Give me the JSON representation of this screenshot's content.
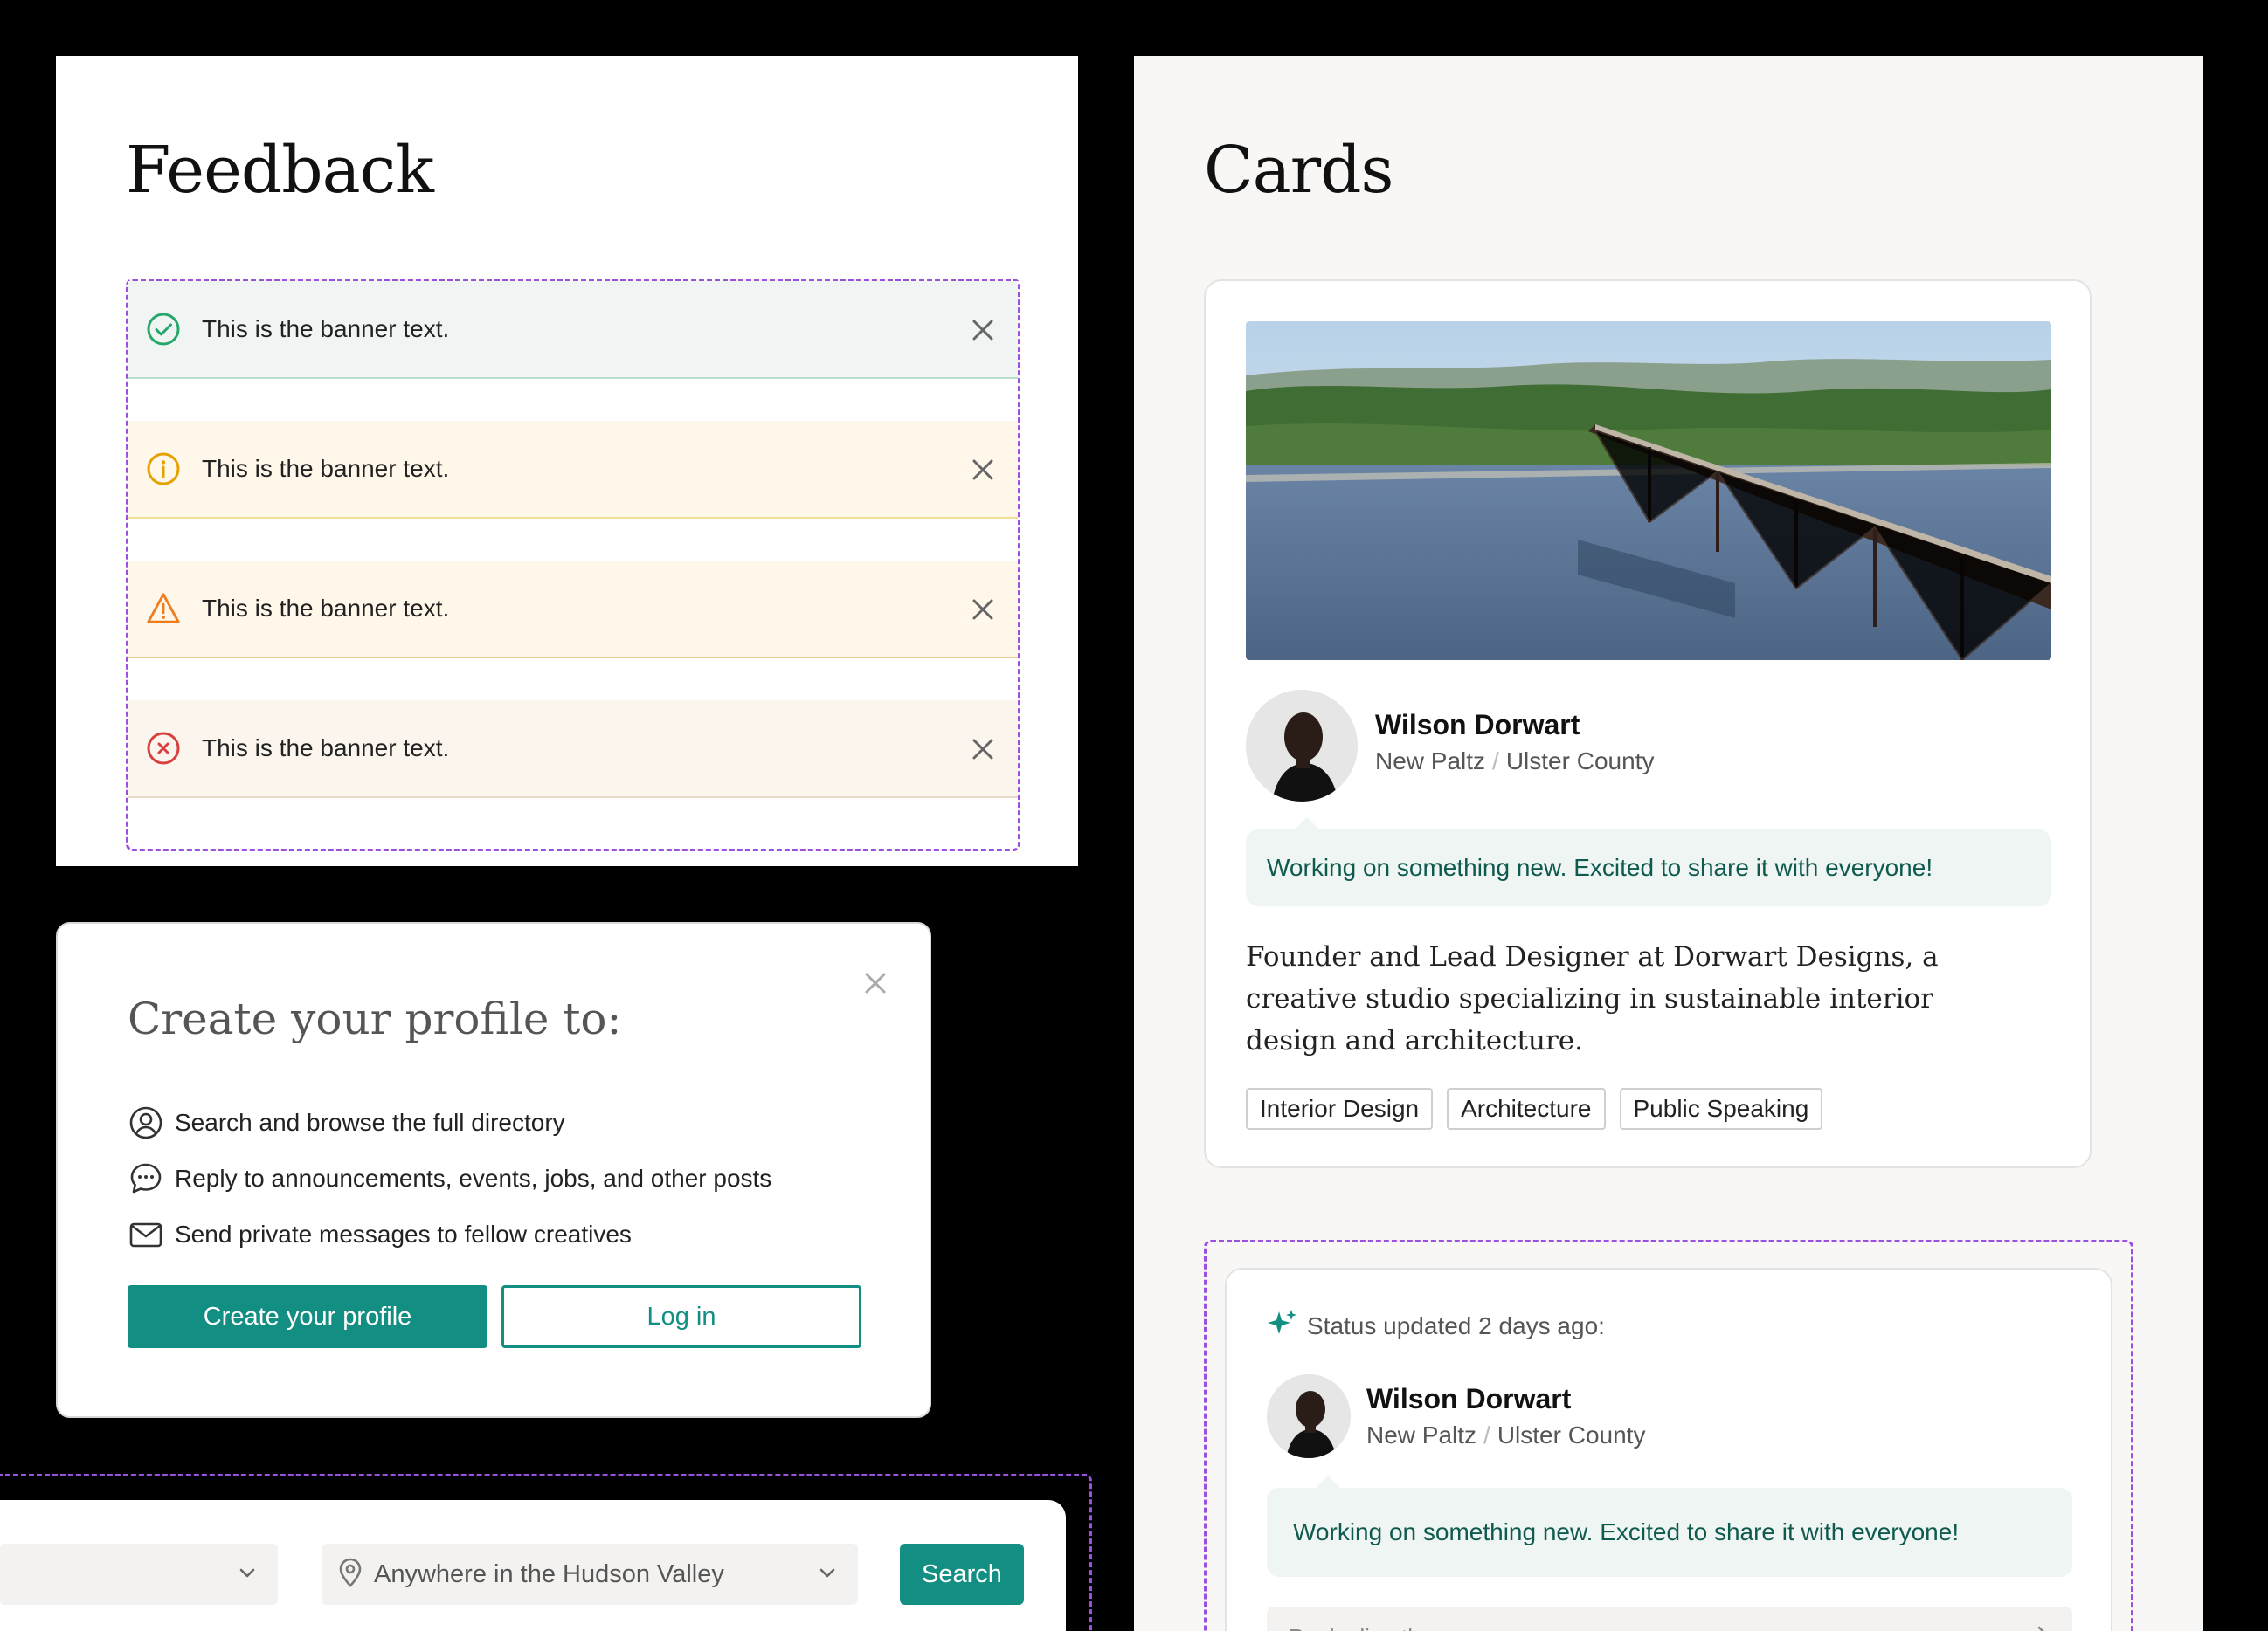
{
  "feedback": {
    "title": "Feedback",
    "banners": [
      {
        "type": "success",
        "text": "This is the banner text.",
        "icon": "check-circle-icon",
        "color": "#27a86b"
      },
      {
        "type": "info",
        "text": "This is the banner text.",
        "icon": "info-circle-icon",
        "color": "#e5a100"
      },
      {
        "type": "warning",
        "text": "This is the banner text.",
        "icon": "warning-triangle-icon",
        "color": "#f07c1b"
      },
      {
        "type": "error",
        "text": "This is the banner text.",
        "icon": "x-circle-icon",
        "color": "#d94040"
      }
    ]
  },
  "profile_prompt": {
    "title": "Create your profile to:",
    "items": [
      {
        "icon": "user-circle-icon",
        "text": "Search and browse the full directory"
      },
      {
        "icon": "chat-bubble-icon",
        "text": "Reply to announcements, events, jobs, and other posts"
      },
      {
        "icon": "envelope-icon",
        "text": "Send private messages to fellow creatives"
      }
    ],
    "primary_button": "Create your profile",
    "secondary_button": "Log in"
  },
  "search": {
    "location_placeholder": "Anywhere in the Hudson Valley",
    "button": "Search"
  },
  "cards": {
    "title": "Cards",
    "profile_card": {
      "name": "Wilson Dorwart",
      "city": "New Paltz",
      "separator": "/",
      "county": "Ulster County",
      "status": "Working on something new. Excited to share it with everyone!",
      "bio": "Founder and Lead Designer at Dorwart Designs, a creative studio specializing in sustainable interior design and architecture.",
      "tags": [
        "Interior Design",
        "Architecture",
        "Public Speaking"
      ]
    },
    "status_card": {
      "header": "Status updated 2 days ago:",
      "name": "Wilson Dorwart",
      "city": "New Paltz",
      "separator": "/",
      "county": "Ulster County",
      "status": "Working on something new. Excited to share it with everyone!",
      "reply_placeholder": "Reply directly"
    }
  },
  "colors": {
    "accent": "#128f82",
    "dashed_outline": "#9b51e0"
  }
}
